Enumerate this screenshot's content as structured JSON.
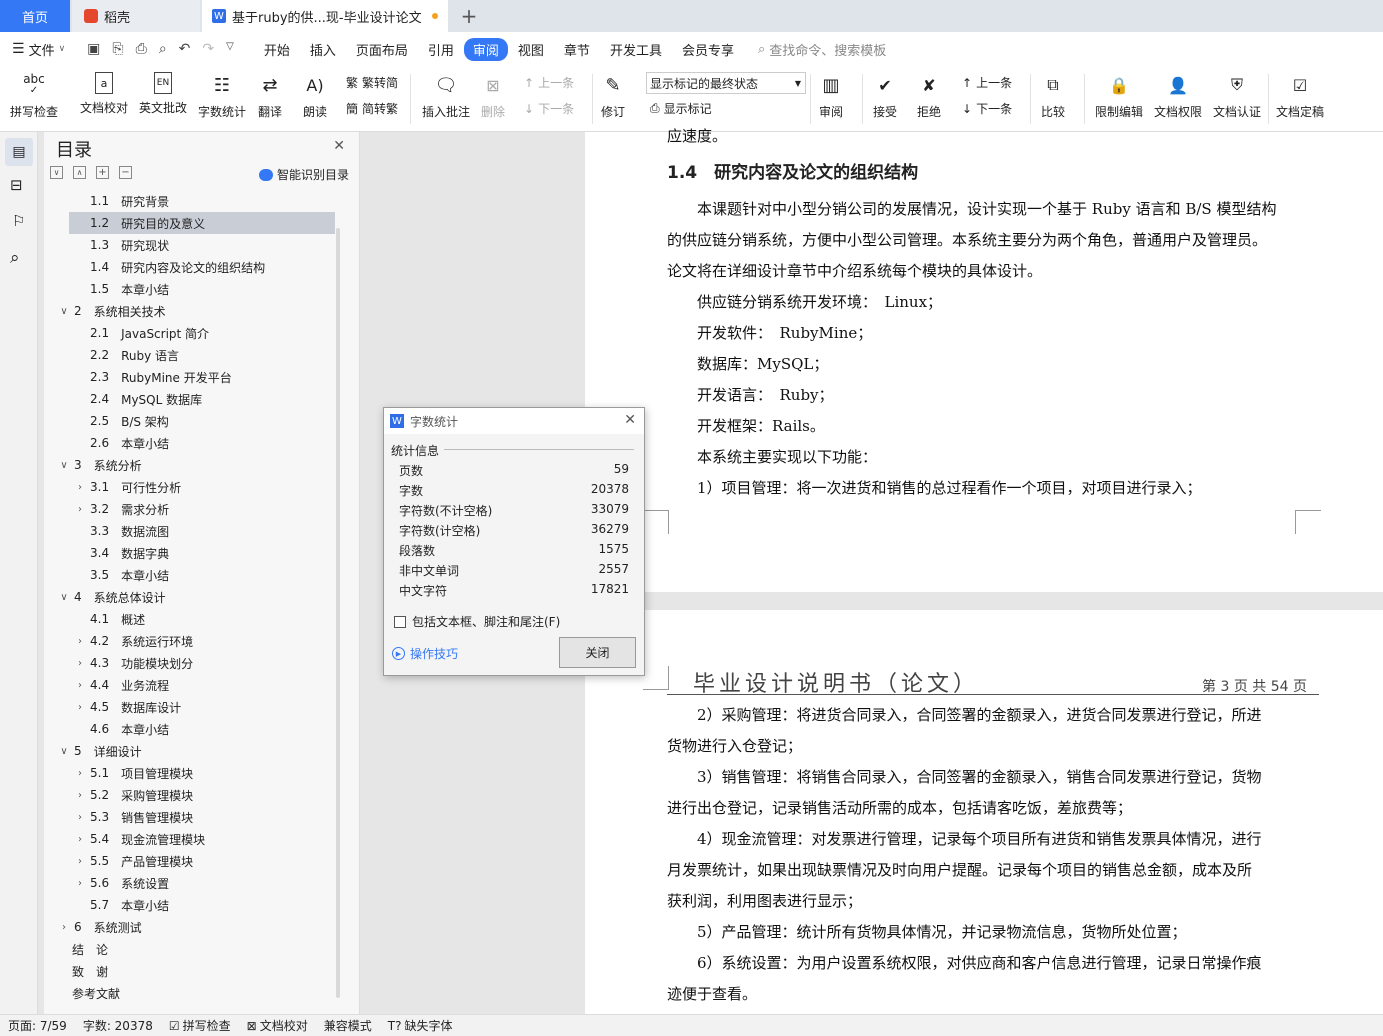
{
  "tabs": {
    "home": "首页",
    "daoke": "稻壳",
    "doc": "基于ruby的供...现-毕业设计论文"
  },
  "menu": {
    "file": "文件",
    "items": [
      "开始",
      "插入",
      "页面布局",
      "引用",
      "审阅",
      "视图",
      "章节",
      "开发工具",
      "会员专享"
    ],
    "search": "查找命令、搜索模板"
  },
  "ribbon": {
    "spell": "拼写检查",
    "proof": "文档校对",
    "enreview": "英文批改",
    "wordcount": "字数统计",
    "translate": "翻译",
    "read": "朗读",
    "t2s": "繁转简",
    "s2t": "简转繁",
    "insert_comment": "插入批注",
    "delete": "删除",
    "prev": "上一条",
    "next": "下一条",
    "revise": "修订",
    "final_state": "显示标记的最终状态",
    "show_marks": "显示标记",
    "review": "审阅",
    "accept": "接受",
    "reject": "拒绝",
    "prev2": "上一条",
    "next2": "下一条",
    "compare": "比较",
    "restrict": "限制编辑",
    "perm": "文档权限",
    "auth": "文档认证",
    "finalize": "文档定稿"
  },
  "toc": {
    "title": "目录",
    "smart": "智能识别目录",
    "items": [
      {
        "n": "1.1",
        "t": "研究背景",
        "lvl": 2,
        "arrow": ""
      },
      {
        "n": "1.2",
        "t": "研究目的及意义",
        "lvl": 2,
        "arrow": "",
        "sel": true
      },
      {
        "n": "1.3",
        "t": "研究现状",
        "lvl": 2,
        "arrow": ""
      },
      {
        "n": "1.4",
        "t": "研究内容及论文的组织结构",
        "lvl": 2,
        "arrow": ""
      },
      {
        "n": "1.5",
        "t": "本章小结",
        "lvl": 2,
        "arrow": ""
      },
      {
        "n": "2",
        "t": "系统相关技术",
        "lvl": 1,
        "arrow": "v"
      },
      {
        "n": "2.1",
        "t": "JavaScript 简介",
        "lvl": 2,
        "arrow": ""
      },
      {
        "n": "2.2",
        "t": "Ruby 语言",
        "lvl": 2,
        "arrow": ""
      },
      {
        "n": "2.3",
        "t": "RubyMine 开发平台",
        "lvl": 2,
        "arrow": ""
      },
      {
        "n": "2.4",
        "t": "MySQL 数据库",
        "lvl": 2,
        "arrow": ""
      },
      {
        "n": "2.5",
        "t": "B/S 架构",
        "lvl": 2,
        "arrow": ""
      },
      {
        "n": "2.6",
        "t": "本章小结",
        "lvl": 2,
        "arrow": ""
      },
      {
        "n": "3",
        "t": "系统分析",
        "lvl": 1,
        "arrow": "v"
      },
      {
        "n": "3.1",
        "t": "可行性分析",
        "lvl": 2,
        "arrow": ">"
      },
      {
        "n": "3.2",
        "t": "需求分析",
        "lvl": 2,
        "arrow": ">"
      },
      {
        "n": "3.3",
        "t": "数据流图",
        "lvl": 2,
        "arrow": ""
      },
      {
        "n": "3.4",
        "t": "数据字典",
        "lvl": 2,
        "arrow": ""
      },
      {
        "n": "3.5",
        "t": "本章小结",
        "lvl": 2,
        "arrow": ""
      },
      {
        "n": "4",
        "t": "系统总体设计",
        "lvl": 1,
        "arrow": "v"
      },
      {
        "n": "4.1",
        "t": "概述",
        "lvl": 2,
        "arrow": ""
      },
      {
        "n": "4.2",
        "t": "系统运行环境",
        "lvl": 2,
        "arrow": ">"
      },
      {
        "n": "4.3",
        "t": "功能模块划分",
        "lvl": 2,
        "arrow": ">"
      },
      {
        "n": "4.4",
        "t": "业务流程",
        "lvl": 2,
        "arrow": ">"
      },
      {
        "n": "4.5",
        "t": "数据库设计",
        "lvl": 2,
        "arrow": ">"
      },
      {
        "n": "4.6",
        "t": "本章小结",
        "lvl": 2,
        "arrow": ""
      },
      {
        "n": "5",
        "t": "详细设计",
        "lvl": 1,
        "arrow": "v"
      },
      {
        "n": "5.1",
        "t": "项目管理模块",
        "lvl": 2,
        "arrow": ">"
      },
      {
        "n": "5.2",
        "t": "采购管理模块",
        "lvl": 2,
        "arrow": ">"
      },
      {
        "n": "5.3",
        "t": "销售管理模块",
        "lvl": 2,
        "arrow": ">"
      },
      {
        "n": "5.4",
        "t": "现金流管理模块",
        "lvl": 2,
        "arrow": ">"
      },
      {
        "n": "5.5",
        "t": "产品管理模块",
        "lvl": 2,
        "arrow": ">"
      },
      {
        "n": "5.6",
        "t": "系统设置",
        "lvl": 2,
        "arrow": ">"
      },
      {
        "n": "5.7",
        "t": "本章小结",
        "lvl": 2,
        "arrow": ""
      },
      {
        "n": "6",
        "t": "系统测试",
        "lvl": 1,
        "arrow": ">"
      },
      {
        "n": "",
        "t": "结　论",
        "lvl": 0,
        "arrow": ""
      },
      {
        "n": "",
        "t": "致　谢",
        "lvl": 0,
        "arrow": ""
      },
      {
        "n": "",
        "t": "参考文献",
        "lvl": 0,
        "arrow": ""
      }
    ]
  },
  "doc": {
    "frag": "应速度。",
    "heading": "1.4　研究内容及论文的组织结构",
    "p1": [
      "　　本课题针对中小型分销公司的发展情况，设计实现一个基于 Ruby 语言和 B/S 模型结构",
      "的供应链分销系统，方便中小型公司管理。本系统主要分为两个角色，普通用户及管理员。",
      "论文将在详细设计章节中介绍系统每个模块的具体设计。",
      "　　供应链分销系统开发环境：　Linux；",
      "　　开发软件：　RubyMine；",
      "　　数据库：MySQL；",
      "　　开发语言：　Ruby；",
      "　　开发框架：Rails。",
      "　　本系统主要实现以下功能：",
      "　　1）项目管理：将一次进货和销售的总过程看作一个项目，对项目进行录入；"
    ],
    "header_title": "毕业设计说明书（论文）",
    "header_page": "第 3 页 共 54 页",
    "p2": [
      "　　2）采购管理：将进货合同录入，合同签署的金额录入，进货合同发票进行登记，所进",
      "货物进行入仓登记；",
      "　　3）销售管理：将销售合同录入，合同签署的金额录入，销售合同发票进行登记，货物",
      "进行出仓登记，记录销售活动所需的成本，包括请客吃饭，差旅费等；",
      "　　4）现金流管理：对发票进行管理，记录每个项目所有进货和销售发票具体情况，进行",
      "月发票统计，如果出现缺票情况及时向用户提醒。记录每个项目的销售总金额，成本及所",
      "获利润，利用图表进行显示；",
      "　　5）产品管理：统计所有货物具体情况，并记录物流信息，货物所处位置；",
      "　　6）系统设置：为用户设置系统权限，对供应商和客户信息进行管理，记录日常操作痕",
      "迹便于查看。"
    ]
  },
  "dialog": {
    "title": "字数统计",
    "section": "统计信息",
    "rows": [
      {
        "k": "页数",
        "v": "59"
      },
      {
        "k": "字数",
        "v": "20378"
      },
      {
        "k": "字符数(不计空格)",
        "v": "33079"
      },
      {
        "k": "字符数(计空格)",
        "v": "36279"
      },
      {
        "k": "段落数",
        "v": "1575"
      },
      {
        "k": "非中文单词",
        "v": "2557"
      },
      {
        "k": "中文字符",
        "v": "17821"
      }
    ],
    "include": "包括文本框、脚注和尾注(F)",
    "tips": "操作技巧",
    "close": "关闭"
  },
  "status": {
    "page": "页面: 7/59",
    "words": "字数: 20378",
    "spell": "拼写检查",
    "proof": "文档校对",
    "compat": "兼容模式",
    "font": "缺失字体"
  },
  "colors": {
    "accent": "#3478f6"
  }
}
